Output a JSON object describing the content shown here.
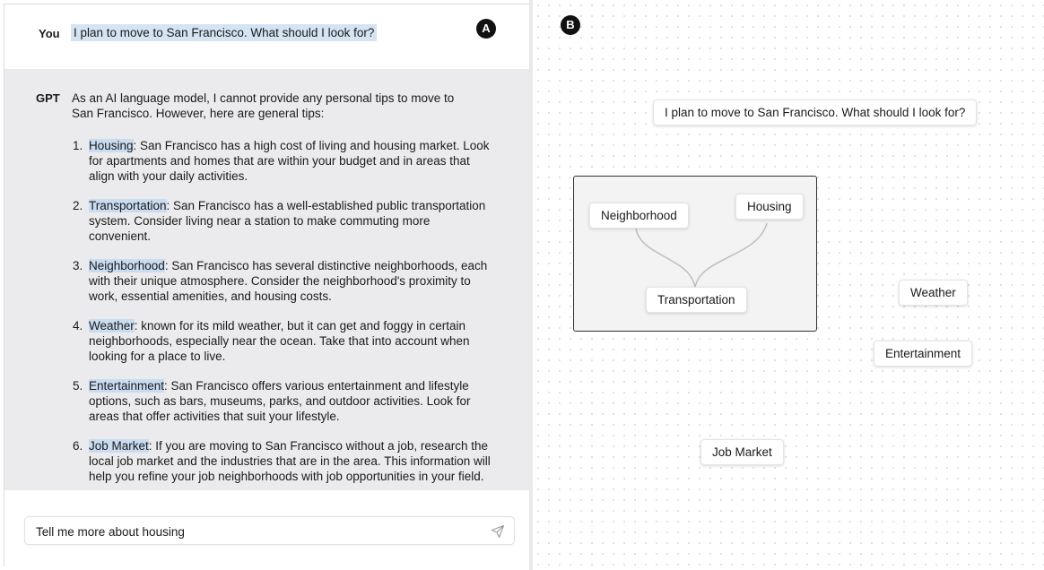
{
  "badges": {
    "left": "A",
    "right": "B"
  },
  "chat": {
    "user_speaker": "You",
    "user_message": "I plan to move to San Francisco. What should I look for?",
    "gpt_speaker": "GPT",
    "gpt_intro": "As an AI language model, I cannot provide any personal tips to move to San Francisco. However, here are general tips:",
    "tips": [
      {
        "num": "1.",
        "keyword": "Housing",
        "text": ": San Francisco has a high cost of living and housing market. Look for apartments and homes that are within your budget and in areas that align with your daily activities."
      },
      {
        "num": "2.",
        "keyword": "Transportation",
        "text": ": San Francisco has a well-established public transportation system. Consider living near a station to make commuting more convenient."
      },
      {
        "num": "3.",
        "keyword": "Neighborhood",
        "text": ": San Francisco has several distinctive neighborhoods, each with their unique atmosphere. Consider the neighborhood's proximity to work, essential amenities, and housing costs."
      },
      {
        "num": "4.",
        "keyword": "Weather",
        "text": ": known for its mild weather, but it can get and foggy in certain neighborhoods, especially near the ocean. Take that into account when looking for a place to live."
      },
      {
        "num": "5.",
        "keyword": "Entertainment",
        "text": ": San Francisco offers various entertainment and lifestyle options, such as bars, museums, parks, and outdoor activities. Look for areas that offer activities that suit your lifestyle."
      },
      {
        "num": "6.",
        "keyword": "Job Market",
        "text": ": If you are moving to San Francisco without a job, research the local job market and the industries that are in the area. This information will help you refine your job neighborhoods with job opportunities in your field."
      }
    ],
    "input_value": "Tell me more about housing",
    "send_icon": "send-icon"
  },
  "canvas": {
    "prompt_node": "I plan to move to San Francisco. What should I look for?",
    "group_nodes": {
      "neighborhood": "Neighborhood",
      "housing": "Housing",
      "transportation": "Transportation"
    },
    "free_nodes": {
      "weather": "Weather",
      "entertainment": "Entertainment",
      "job_market": "Job Market"
    }
  },
  "colors": {
    "highlight": "#c9dcf0",
    "gpt_background": "#ebebed",
    "badge": "#111111"
  }
}
